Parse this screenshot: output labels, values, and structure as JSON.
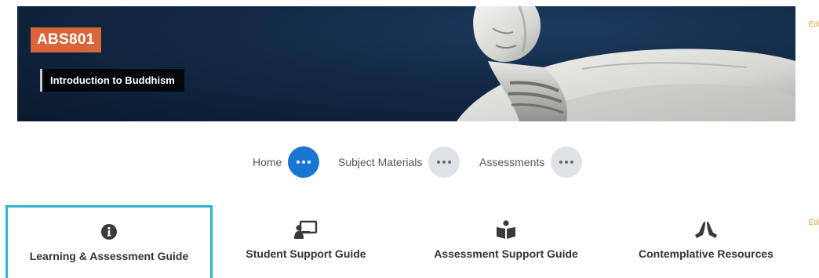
{
  "banner": {
    "subject_code": "ABS801",
    "subject_title": "Introduction to Buddhism",
    "edit_label": "Edit"
  },
  "nav": {
    "items": [
      {
        "label": "Home",
        "active": true
      },
      {
        "label": "Subject Materials",
        "active": false
      },
      {
        "label": "Assessments",
        "active": false
      }
    ]
  },
  "guides": {
    "edit_label": "Edit",
    "items": [
      {
        "label": "Learning & Assessment Guide",
        "icon": "info-circle-icon",
        "selected": true
      },
      {
        "label": "Student Support Guide",
        "icon": "presenter-board-icon",
        "selected": false
      },
      {
        "label": "Assessment Support Guide",
        "icon": "reader-book-icon",
        "selected": false
      },
      {
        "label": "Contemplative Resources",
        "icon": "praying-hands-icon",
        "selected": false
      }
    ]
  },
  "colors": {
    "badge": "#d9663a",
    "nav_active": "#1976d2",
    "nav_inactive": "#dfe3e8",
    "selected_border": "#2fb4cc",
    "edit_link": "#e0a020"
  }
}
